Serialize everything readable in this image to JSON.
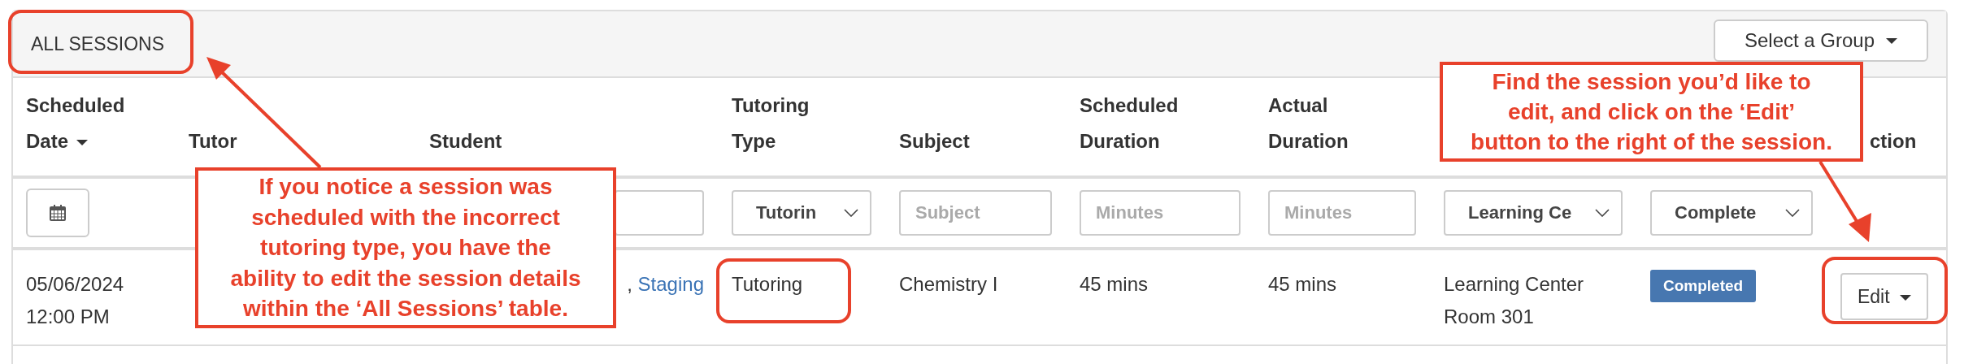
{
  "panel": {
    "title": "ALL SESSIONS",
    "group_button": "Select a Group"
  },
  "table": {
    "columns": [
      {
        "label": "Scheduled Date",
        "sorted": true
      },
      {
        "label": "Tutor"
      },
      {
        "label": "Student"
      },
      {
        "label": "Tutoring Type"
      },
      {
        "label": "Subject"
      },
      {
        "label": "Scheduled Duration"
      },
      {
        "label": "Actual Duration"
      },
      {},
      {},
      {
        "label": "ction"
      }
    ],
    "filters": [
      {
        "kind": "date"
      },
      {
        "kind": "hidden"
      },
      {
        "kind": "partial"
      },
      {
        "kind": "select",
        "value": "Tutorin"
      },
      {
        "kind": "text",
        "placeholder": "Subject"
      },
      {
        "kind": "text",
        "placeholder": "Minutes"
      },
      {
        "kind": "text",
        "placeholder": "Minutes"
      },
      {
        "kind": "select",
        "value": "Learning Ce"
      },
      {
        "kind": "select",
        "value": "Complete"
      },
      {
        "kind": "none"
      }
    ],
    "rows": [
      {
        "date": "05/06/2024",
        "time": "12:00 PM",
        "student_prefix": ",",
        "student_link": "Staging",
        "tutoring_type": "Tutoring",
        "subject": "Chemistry I",
        "scheduled_duration": "45 mins",
        "actual_duration": "45 mins",
        "location": "Learning Center Room 301",
        "status": "Completed",
        "action": "Edit"
      }
    ]
  },
  "callouts": [
    {
      "text": "If you notice a session was\nscheduled with the incorrect\ntutoring type, you have the\nability to edit the session details\nwithin the ‘All Sessions’ table."
    },
    {
      "text": "Find the session you’d like to\nedit, and click on the ‘Edit’\nbutton to the right of the session."
    }
  ]
}
